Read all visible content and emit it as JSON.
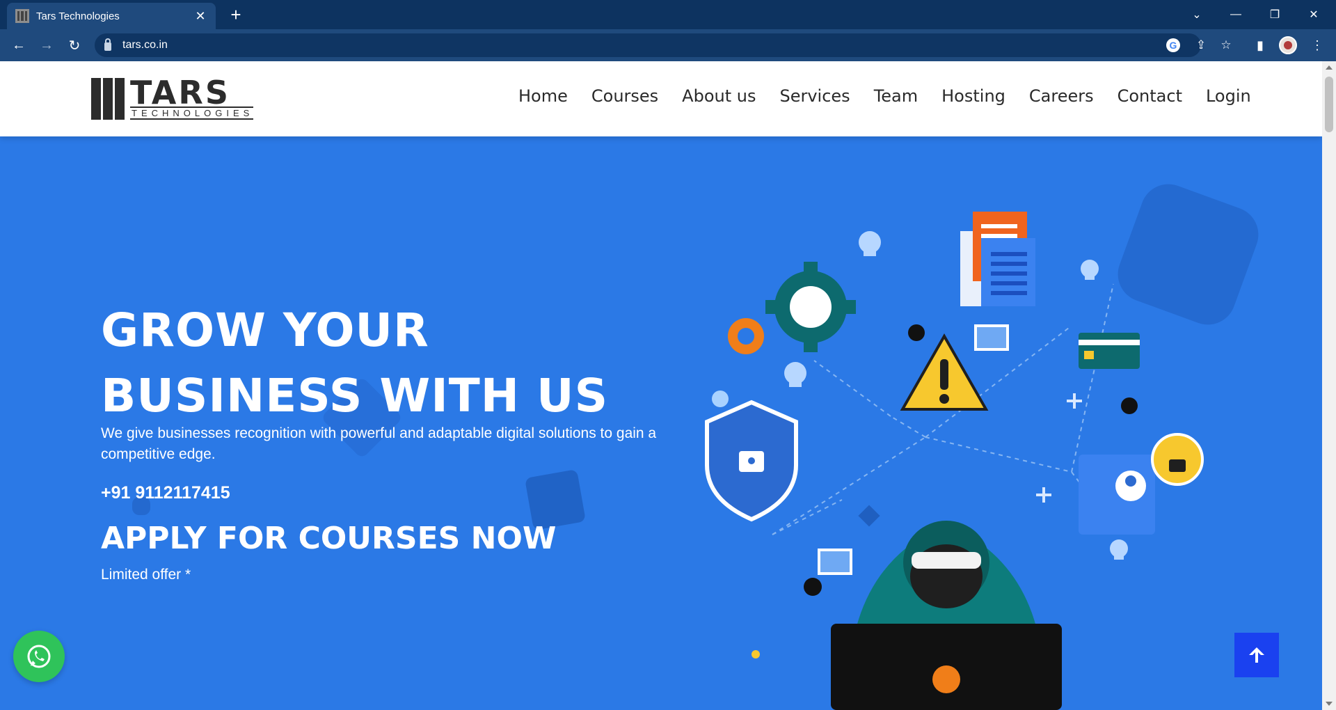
{
  "browser": {
    "tab_title": "Tars Technologies",
    "url": "tars.co.in"
  },
  "site": {
    "logo_main": "TARS",
    "logo_sub": "TECHNOLOGIES",
    "nav": [
      "Home",
      "Courses",
      "About us",
      "Services",
      "Team",
      "Hosting",
      "Careers",
      "Contact",
      "Login"
    ]
  },
  "hero": {
    "headline_line1": "GROW YOUR",
    "headline_line2": "BUSINESS WITH US",
    "description": "We give businesses recognition with powerful and adaptable digital solutions to gain a competitive edge.",
    "phone": "+91 9112117415",
    "cta": "APPLY FOR COURSES NOW",
    "note": "Limited offer *"
  },
  "colors": {
    "hero_bg": "#2b79e6",
    "browser_dark": "#0d3360",
    "whatsapp": "#2fc35a",
    "scroll_top": "#1a41f0"
  },
  "icons": [
    "whatsapp-icon",
    "arrow-up-icon",
    "back-icon",
    "forward-icon",
    "reload-icon",
    "lock-icon",
    "star-icon",
    "share-icon",
    "google-icon",
    "side-panel-icon"
  ]
}
